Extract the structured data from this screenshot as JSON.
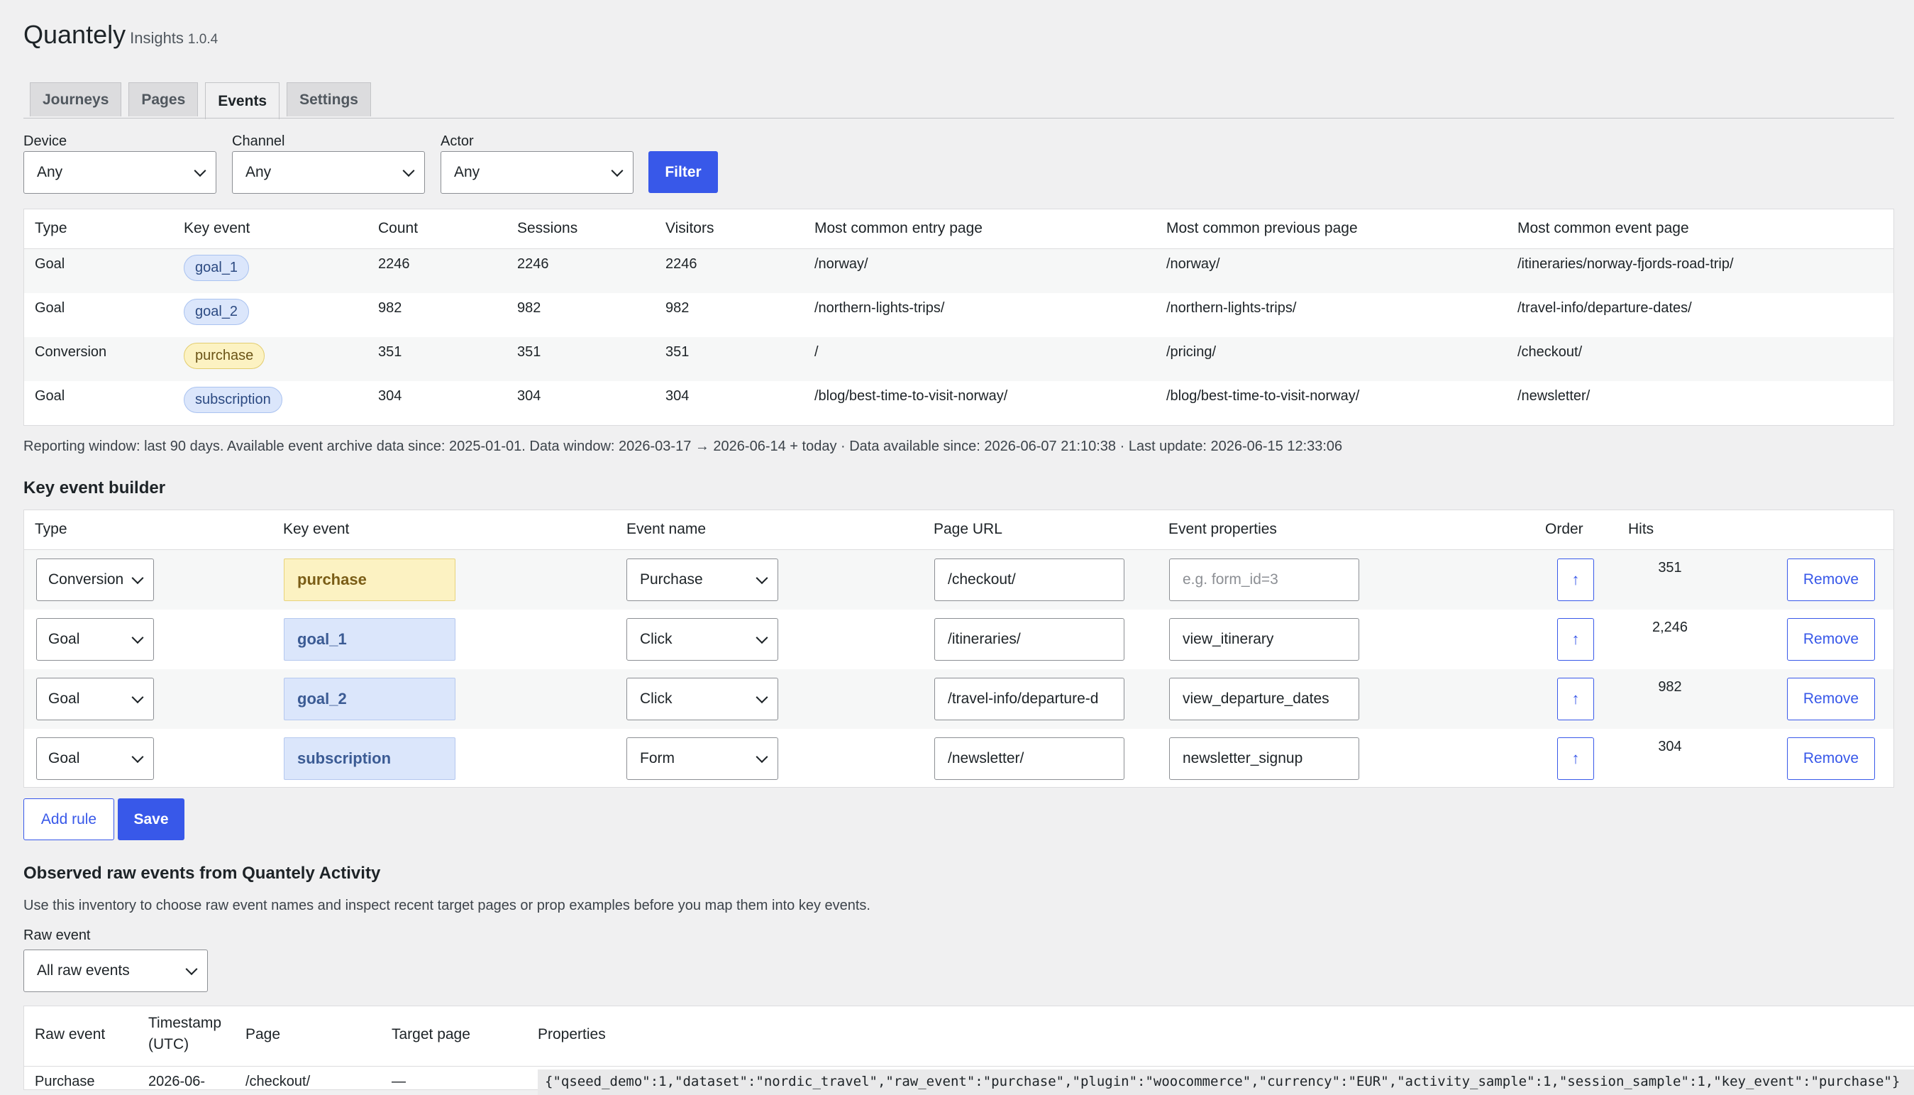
{
  "header": {
    "title": "Quantely",
    "subtitle": "Insights",
    "version": "1.0.4"
  },
  "tabs": [
    {
      "label": "Journeys"
    },
    {
      "label": "Pages"
    },
    {
      "label": "Events",
      "active": true
    },
    {
      "label": "Settings"
    }
  ],
  "filters": {
    "device": {
      "label": "Device",
      "value": "Any"
    },
    "channel": {
      "label": "Channel",
      "value": "Any"
    },
    "actor": {
      "label": "Actor",
      "value": "Any"
    },
    "filter_button": "Filter"
  },
  "events_table": {
    "columns": [
      "Type",
      "Key event",
      "Count",
      "Sessions",
      "Visitors",
      "Most common entry page",
      "Most common previous page",
      "Most common event page"
    ],
    "rows": [
      {
        "type": "Goal",
        "key": "goal_1",
        "kind": "goal",
        "count": "2246",
        "sessions": "2246",
        "visitors": "2246",
        "entry": "/norway/",
        "previous": "/norway/",
        "event_page": "/itineraries/norway-fjords-road-trip/"
      },
      {
        "type": "Goal",
        "key": "goal_2",
        "kind": "goal",
        "count": "982",
        "sessions": "982",
        "visitors": "982",
        "entry": "/northern-lights-trips/",
        "previous": "/northern-lights-trips/",
        "event_page": "/travel-info/departure-dates/"
      },
      {
        "type": "Conversion",
        "key": "purchase",
        "kind": "conv",
        "count": "351",
        "sessions": "351",
        "visitors": "351",
        "entry": "/",
        "previous": "/pricing/",
        "event_page": "/checkout/"
      },
      {
        "type": "Goal",
        "key": "subscription",
        "kind": "goal",
        "count": "304",
        "sessions": "304",
        "visitors": "304",
        "entry": "/blog/best-time-to-visit-norway/",
        "previous": "/blog/best-time-to-visit-norway/",
        "event_page": "/newsletter/"
      }
    ]
  },
  "reporting_note": "Reporting window: last 90 days. Available event archive data since: 2025-01-01. Data window: 2026-03-17 → 2026-06-14 + today · Data available since: 2026-06-07 21:10:38 · Last update: 2026-06-15 12:33:06",
  "builder": {
    "heading": "Key event builder",
    "columns": [
      "Type",
      "Key event",
      "Event name",
      "Page URL",
      "Event properties",
      "Order",
      "Hits"
    ],
    "rows": [
      {
        "type": "Conversion",
        "key": "purchase",
        "kind": "conv",
        "event_name": "Purchase",
        "page_url": "/checkout/",
        "props": "",
        "props_placeholder": "e.g. form_id=3",
        "order_icon": "↑",
        "hits": "351",
        "remove": "Remove"
      },
      {
        "type": "Goal",
        "key": "goal_1",
        "kind": "goal",
        "event_name": "Click",
        "page_url": "/itineraries/",
        "props": "view_itinerary",
        "props_placeholder": "",
        "order_icon": "↑",
        "hits": "2,246",
        "remove": "Remove"
      },
      {
        "type": "Goal",
        "key": "goal_2",
        "kind": "goal",
        "event_name": "Click",
        "page_url": "/travel-info/departure-d",
        "props": "view_departure_dates",
        "props_placeholder": "",
        "order_icon": "↑",
        "hits": "982",
        "remove": "Remove"
      },
      {
        "type": "Goal",
        "key": "subscription",
        "kind": "goal",
        "event_name": "Form",
        "page_url": "/newsletter/",
        "props": "newsletter_signup",
        "props_placeholder": "",
        "order_icon": "↑",
        "hits": "304",
        "remove": "Remove"
      }
    ],
    "add_rule": "Add rule",
    "save": "Save"
  },
  "raw": {
    "heading": "Observed raw events from Quantely Activity",
    "description": "Use this inventory to choose raw event names and inspect recent target pages or prop examples before you map them into key events.",
    "filter_label": "Raw event",
    "filter_value": "All raw events",
    "columns": {
      "raw_event": "Raw event",
      "timestamp_1": "Timestamp",
      "timestamp_2": "(UTC)",
      "page": "Page",
      "target": "Target page",
      "props": "Properties"
    },
    "first_row": {
      "raw_event": "Purchase",
      "timestamp": "2026-06-",
      "page": "/checkout/",
      "target": "—",
      "props": "{\"qseed_demo\":1,\"dataset\":\"nordic_travel\",\"raw_event\":\"purchase\",\"plugin\":\"woocommerce\",\"currency\":\"EUR\",\"activity_sample\":1,\"session_sample\":1,\"key_event\":\"purchase\"}"
    }
  }
}
